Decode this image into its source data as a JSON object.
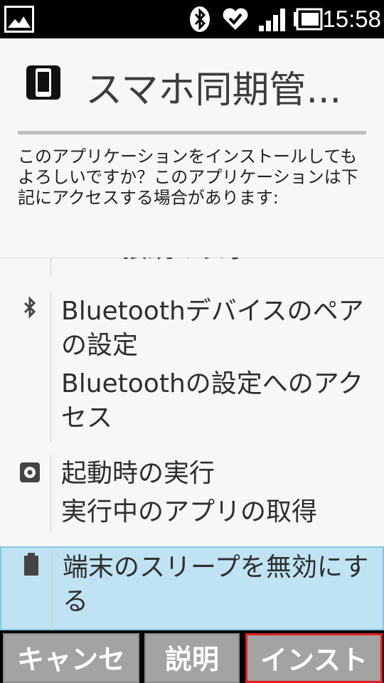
{
  "status_bar": {
    "time": "15:58",
    "icons": [
      "image-notification-icon",
      "bluetooth-icon",
      "health-heart-icon",
      "signal-icon",
      "battery-icon"
    ]
  },
  "app": {
    "title": "スマホ同期管...",
    "icon": "phone-icon"
  },
  "install_question": "このアプリケーションをインストールしてもよろしいですか？このアプリケーションは下記にアクセスする場合があります:",
  "permissions": [
    {
      "icon": "",
      "items": [
        "Wi-Fi接続の表示"
      ]
    },
    {
      "icon": "bluetooth-icon",
      "items": [
        "Bluetoothデバイスのペアの設定",
        "Bluetoothの設定へのアクセス"
      ]
    },
    {
      "icon": "gear-icon",
      "items": [
        "起動時の実行",
        "実行中のアプリの取得"
      ]
    },
    {
      "icon": "battery-icon",
      "items": [
        "端末のスリープを無効にする"
      ],
      "highlighted": true
    }
  ],
  "buttons": {
    "cancel": "キャンセル",
    "help": "説明",
    "install": "インストール"
  },
  "colors": {
    "highlight": "#bfe3f3",
    "highlight_border": "#85c6e4",
    "button_bg": "#a3a3a3",
    "install_border": "#e01e1e"
  }
}
